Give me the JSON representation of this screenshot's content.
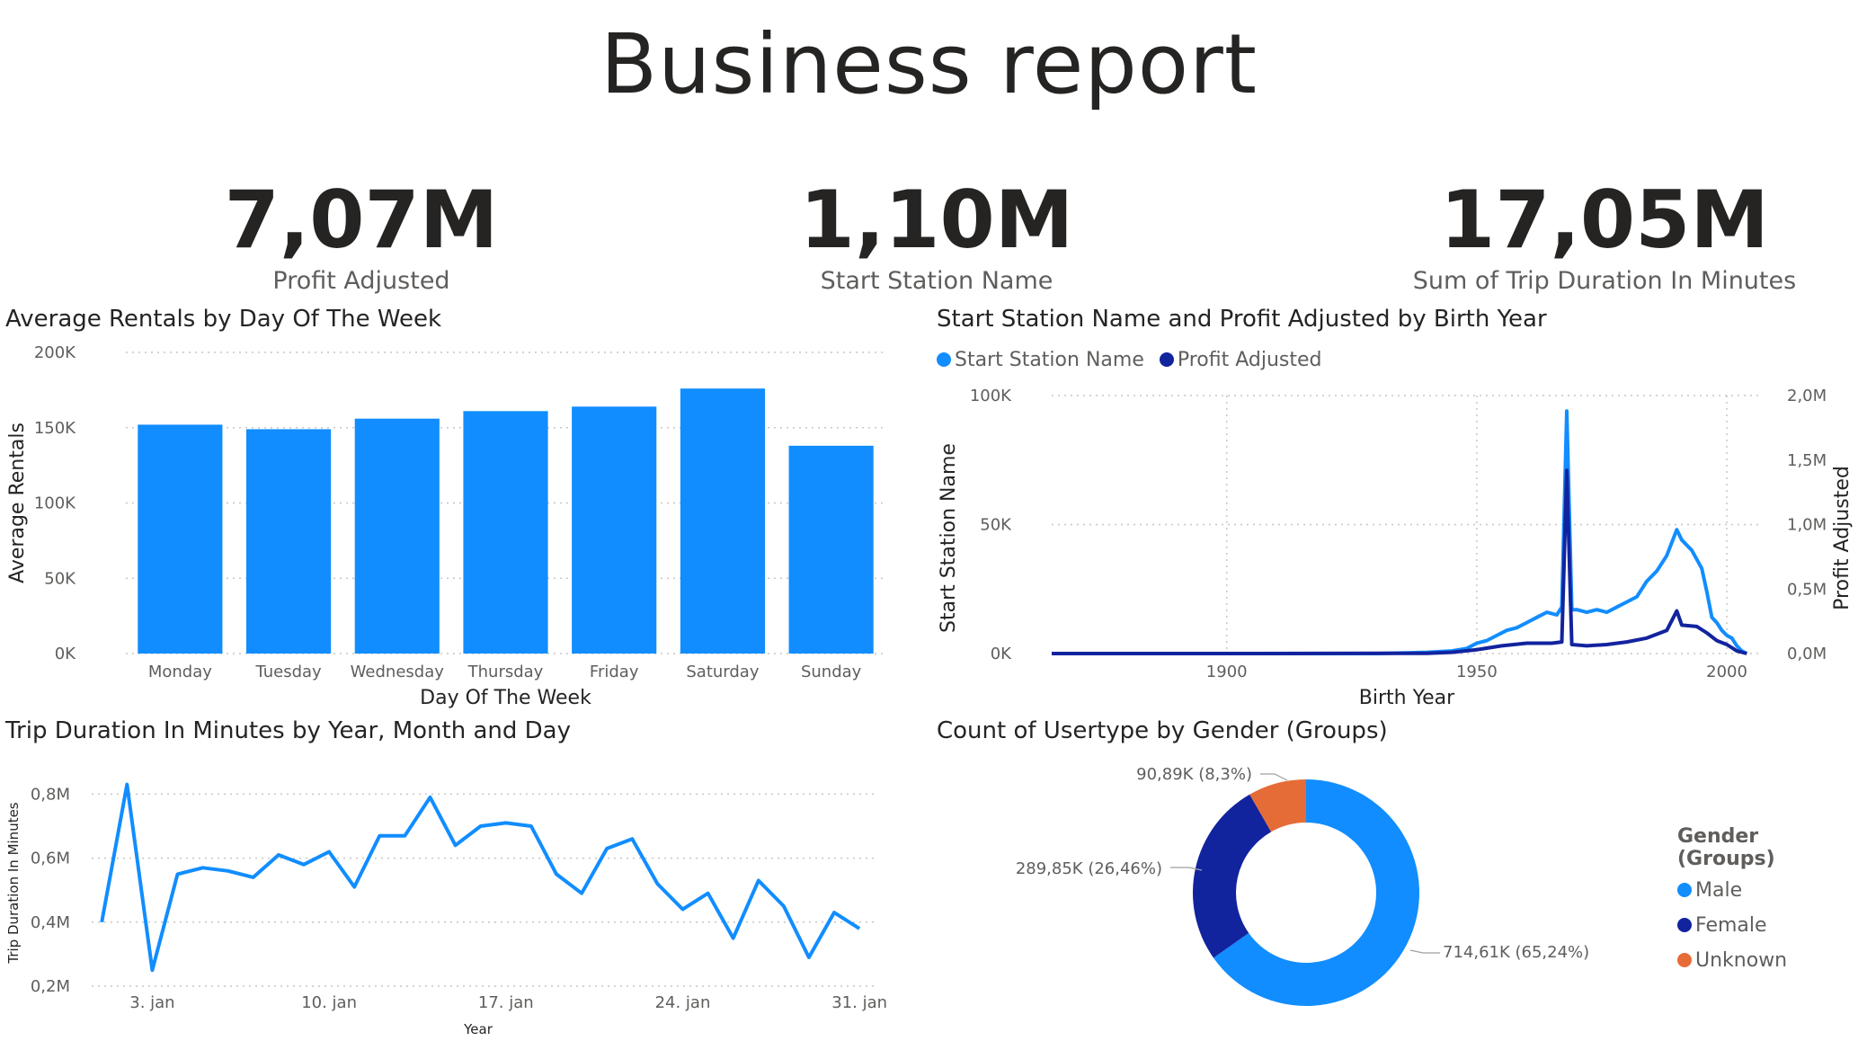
{
  "report": {
    "title": "Business report"
  },
  "kpis": [
    {
      "value": "7,07M",
      "label": "Profit Adjusted"
    },
    {
      "value": "1,10M",
      "label": "Start Station Name"
    },
    {
      "value": "17,05M",
      "label": "Sum of Trip Duration In Minutes"
    }
  ],
  "colors": {
    "primary": "#118DFF",
    "dark": "#12239E",
    "orange": "#E66C37",
    "grid": "#C8C6C4"
  },
  "chart_data": [
    {
      "type": "bar",
      "title": "Average Rentals by Day Of The Week",
      "xlabel": "Day Of The Week",
      "ylabel": "Average Rentals",
      "categories": [
        "Monday",
        "Tuesday",
        "Wednesday",
        "Thursday",
        "Friday",
        "Saturday",
        "Sunday"
      ],
      "values": [
        152000,
        149000,
        156000,
        161000,
        164000,
        176000,
        138000
      ],
      "ylim": [
        0,
        200000
      ],
      "yticks": [
        {
          "v": 0,
          "label": "0K"
        },
        {
          "v": 50000,
          "label": "50K"
        },
        {
          "v": 100000,
          "label": "100K"
        },
        {
          "v": 150000,
          "label": "150K"
        },
        {
          "v": 200000,
          "label": "200K"
        }
      ],
      "grid": true
    },
    {
      "type": "line",
      "title": "Start Station Name and Profit Adjusted by Birth Year",
      "xlabel": "Birth Year",
      "ylabel": "Start Station Name",
      "y2label": "Profit Adjusted",
      "xlim": [
        1865,
        2007
      ],
      "ylim": [
        0,
        100000
      ],
      "y2lim": [
        0,
        2000000
      ],
      "xticks": [
        {
          "v": 1900,
          "label": "1900"
        },
        {
          "v": 1950,
          "label": "1950"
        },
        {
          "v": 2000,
          "label": "2000"
        }
      ],
      "yticks": [
        {
          "v": 0,
          "label": "0K"
        },
        {
          "v": 50000,
          "label": "50K"
        },
        {
          "v": 100000,
          "label": "100K"
        }
      ],
      "y2ticks": [
        {
          "v": 0,
          "label": "0,0M"
        },
        {
          "v": 500000,
          "label": "0,5M"
        },
        {
          "v": 1000000,
          "label": "1,0M"
        },
        {
          "v": 1500000,
          "label": "1,5M"
        },
        {
          "v": 2000000,
          "label": "2,0M"
        }
      ],
      "legend_position": "top-left",
      "series": [
        {
          "name": "Start Station Name",
          "axis": "left",
          "points": [
            [
              1865,
              0
            ],
            [
              1900,
              0
            ],
            [
              1930,
              0
            ],
            [
              1937,
              300
            ],
            [
              1940,
              500
            ],
            [
              1945,
              1000
            ],
            [
              1948,
              2000
            ],
            [
              1950,
              4000
            ],
            [
              1952,
              5000
            ],
            [
              1954,
              7000
            ],
            [
              1956,
              9000
            ],
            [
              1958,
              10000
            ],
            [
              1960,
              12000
            ],
            [
              1962,
              14000
            ],
            [
              1964,
              16000
            ],
            [
              1966,
              15000
            ],
            [
              1967,
              18000
            ],
            [
              1968,
              94000
            ],
            [
              1969,
              17000
            ],
            [
              1970,
              17000
            ],
            [
              1972,
              16000
            ],
            [
              1974,
              17000
            ],
            [
              1976,
              16000
            ],
            [
              1978,
              18000
            ],
            [
              1980,
              20000
            ],
            [
              1982,
              22000
            ],
            [
              1984,
              28000
            ],
            [
              1986,
              32000
            ],
            [
              1988,
              38000
            ],
            [
              1990,
              48000
            ],
            [
              1991,
              44000
            ],
            [
              1993,
              40000
            ],
            [
              1995,
              33000
            ],
            [
              1996,
              24000
            ],
            [
              1997,
              14000
            ],
            [
              1998,
              12000
            ],
            [
              1999,
              9000
            ],
            [
              2000,
              7000
            ],
            [
              2001,
              6000
            ],
            [
              2002,
              3000
            ],
            [
              2003,
              1000
            ],
            [
              2004,
              0
            ]
          ]
        },
        {
          "name": "Profit Adjusted",
          "axis": "right",
          "points": [
            [
              1865,
              0
            ],
            [
              1900,
              0
            ],
            [
              1940,
              2000
            ],
            [
              1945,
              10000
            ],
            [
              1950,
              30000
            ],
            [
              1955,
              60000
            ],
            [
              1960,
              80000
            ],
            [
              1965,
              80000
            ],
            [
              1967,
              90000
            ],
            [
              1968,
              1420000
            ],
            [
              1969,
              70000
            ],
            [
              1972,
              60000
            ],
            [
              1976,
              70000
            ],
            [
              1980,
              90000
            ],
            [
              1984,
              120000
            ],
            [
              1988,
              180000
            ],
            [
              1990,
              330000
            ],
            [
              1991,
              220000
            ],
            [
              1994,
              210000
            ],
            [
              1996,
              160000
            ],
            [
              1998,
              100000
            ],
            [
              2000,
              70000
            ],
            [
              2002,
              20000
            ],
            [
              2004,
              0
            ]
          ]
        }
      ]
    },
    {
      "type": "line",
      "title": "Trip Duration In Minutes by Year, Month and Day",
      "xlabel": "Year",
      "ylabel": "Trip Duration In Minutes",
      "xlim": [
        0.6,
        31.6
      ],
      "ylim": [
        0.2,
        0.86
      ],
      "xticks": [
        {
          "v": 3,
          "label": "3. jan"
        },
        {
          "v": 10,
          "label": "10. jan"
        },
        {
          "v": 17,
          "label": "17. jan"
        },
        {
          "v": 24,
          "label": "24. jan"
        },
        {
          "v": 31,
          "label": "31. jan"
        }
      ],
      "yticks": [
        {
          "v": 0.2,
          "label": "0,2M"
        },
        {
          "v": 0.4,
          "label": "0,4M"
        },
        {
          "v": 0.6,
          "label": "0,6M"
        },
        {
          "v": 0.8,
          "label": "0,8M"
        }
      ],
      "x": [
        1,
        2,
        3,
        4,
        5,
        6,
        7,
        8,
        9,
        10,
        11,
        12,
        13,
        14,
        15,
        16,
        17,
        18,
        19,
        20,
        21,
        22,
        23,
        24,
        25,
        26,
        27,
        28,
        29,
        30,
        31
      ],
      "series": [
        {
          "values": [
            0.4,
            0.83,
            0.25,
            0.55,
            0.57,
            0.56,
            0.54,
            0.61,
            0.58,
            0.62,
            0.51,
            0.67,
            0.67,
            0.79,
            0.64,
            0.7,
            0.71,
            0.7,
            0.55,
            0.49,
            0.63,
            0.66,
            0.52,
            0.44,
            0.49,
            0.35,
            0.53,
            0.45,
            0.29,
            0.43,
            0.38
          ]
        }
      ]
    },
    {
      "type": "pie",
      "title": "Count of Usertype by Gender (Groups)",
      "legend_title": "Gender (Groups)",
      "legend_position": "right",
      "slices": [
        {
          "name": "Male",
          "value": 714610,
          "label": "714,61K (65,24%)"
        },
        {
          "name": "Female",
          "value": 289850,
          "label": "289,85K (26,46%)"
        },
        {
          "name": "Unknown",
          "value": 90890,
          "label": "90,89K (8,3%)"
        }
      ]
    }
  ]
}
